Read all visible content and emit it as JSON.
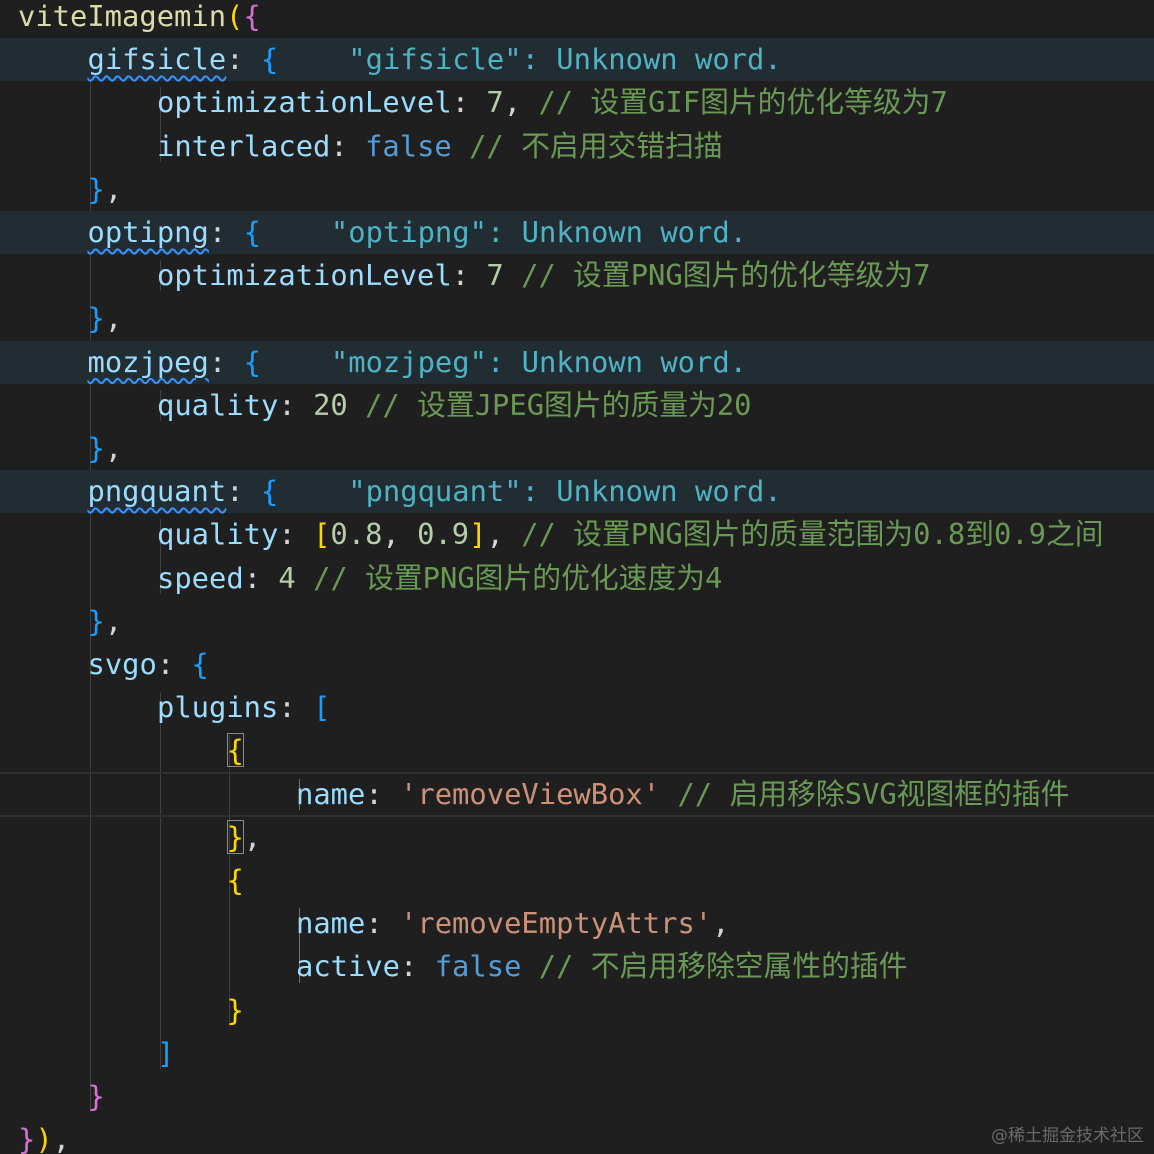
{
  "colors": {
    "background": "#1f1f1f",
    "highlight_row": "#222c33",
    "function": "#dcdcaa",
    "property": "#9cdcfe",
    "number": "#b5cea8",
    "keyword": "#569cd6",
    "string": "#ce9178",
    "comment": "#6a9955",
    "bracket_level1": "#ffd700",
    "bracket_level2": "#da70d6",
    "bracket_level3": "#179fff",
    "diagnostic": "#4fb3c4",
    "squiggle": "#3794ff"
  },
  "lines": [
    {
      "indent": 0,
      "tokens": [
        {
          "t": "viteImagemin",
          "c": "fn"
        },
        {
          "t": "(",
          "c": "b1"
        },
        {
          "t": "{",
          "c": "b2"
        }
      ]
    },
    {
      "indent": 1,
      "highlight": true,
      "diagnostic": "\"gifsicle\": Unknown word.",
      "tokens": [
        {
          "t": "gifsicle",
          "c": "key",
          "squiggle": true
        },
        {
          "t": ": ",
          "c": "punc"
        },
        {
          "t": "{",
          "c": "b3"
        }
      ]
    },
    {
      "indent": 2,
      "tokens": [
        {
          "t": "optimizationLevel",
          "c": "key"
        },
        {
          "t": ": ",
          "c": "punc"
        },
        {
          "t": "7",
          "c": "num"
        },
        {
          "t": ", ",
          "c": "punc"
        },
        {
          "t": "// 设置GIF图片的优化等级为7",
          "c": "cmt"
        }
      ]
    },
    {
      "indent": 2,
      "tokens": [
        {
          "t": "interlaced",
          "c": "key"
        },
        {
          "t": ": ",
          "c": "punc"
        },
        {
          "t": "false",
          "c": "bool"
        },
        {
          "t": " ",
          "c": "punc"
        },
        {
          "t": "// 不启用交错扫描",
          "c": "cmt"
        }
      ]
    },
    {
      "indent": 1,
      "tokens": [
        {
          "t": "}",
          "c": "b3"
        },
        {
          "t": ",",
          "c": "punc"
        }
      ]
    },
    {
      "indent": 1,
      "highlight": true,
      "diagnostic": "\"optipng\": Unknown word.",
      "tokens": [
        {
          "t": "optipng",
          "c": "key",
          "squiggle": true
        },
        {
          "t": ": ",
          "c": "punc"
        },
        {
          "t": "{",
          "c": "b3"
        }
      ]
    },
    {
      "indent": 2,
      "tokens": [
        {
          "t": "optimizationLevel",
          "c": "key"
        },
        {
          "t": ": ",
          "c": "punc"
        },
        {
          "t": "7",
          "c": "num"
        },
        {
          "t": " ",
          "c": "punc"
        },
        {
          "t": "// 设置PNG图片的优化等级为7",
          "c": "cmt"
        }
      ]
    },
    {
      "indent": 1,
      "tokens": [
        {
          "t": "}",
          "c": "b3"
        },
        {
          "t": ",",
          "c": "punc"
        }
      ]
    },
    {
      "indent": 1,
      "highlight": true,
      "diagnostic": "\"mozjpeg\": Unknown word.",
      "tokens": [
        {
          "t": "mozjpeg",
          "c": "key",
          "squiggle": true
        },
        {
          "t": ": ",
          "c": "punc"
        },
        {
          "t": "{",
          "c": "b3"
        }
      ]
    },
    {
      "indent": 2,
      "tokens": [
        {
          "t": "quality",
          "c": "key"
        },
        {
          "t": ": ",
          "c": "punc"
        },
        {
          "t": "20",
          "c": "num"
        },
        {
          "t": " ",
          "c": "punc"
        },
        {
          "t": "// 设置JPEG图片的质量为20",
          "c": "cmt"
        }
      ]
    },
    {
      "indent": 1,
      "tokens": [
        {
          "t": "}",
          "c": "b3"
        },
        {
          "t": ",",
          "c": "punc"
        }
      ]
    },
    {
      "indent": 1,
      "highlight": true,
      "diagnostic": "\"pngquant\": Unknown word.",
      "tokens": [
        {
          "t": "pngquant",
          "c": "key",
          "squiggle": true
        },
        {
          "t": ": ",
          "c": "punc"
        },
        {
          "t": "{",
          "c": "b3"
        }
      ]
    },
    {
      "indent": 2,
      "tokens": [
        {
          "t": "quality",
          "c": "key"
        },
        {
          "t": ": ",
          "c": "punc"
        },
        {
          "t": "[",
          "c": "b1"
        },
        {
          "t": "0.8",
          "c": "num"
        },
        {
          "t": ", ",
          "c": "punc"
        },
        {
          "t": "0.9",
          "c": "num"
        },
        {
          "t": "]",
          "c": "b1"
        },
        {
          "t": ", ",
          "c": "punc"
        },
        {
          "t": "// 设置PNG图片的质量范围为0.8到0.9之间",
          "c": "cmt"
        }
      ]
    },
    {
      "indent": 2,
      "tokens": [
        {
          "t": "speed",
          "c": "key"
        },
        {
          "t": ": ",
          "c": "punc"
        },
        {
          "t": "4",
          "c": "num"
        },
        {
          "t": " ",
          "c": "punc"
        },
        {
          "t": "// 设置PNG图片的优化速度为4",
          "c": "cmt"
        }
      ]
    },
    {
      "indent": 1,
      "tokens": [
        {
          "t": "}",
          "c": "b3"
        },
        {
          "t": ",",
          "c": "punc"
        }
      ]
    },
    {
      "indent": 1,
      "tokens": [
        {
          "t": "svgo",
          "c": "key"
        },
        {
          "t": ": ",
          "c": "punc"
        },
        {
          "t": "{",
          "c": "b3"
        }
      ]
    },
    {
      "indent": 2,
      "tokens": [
        {
          "t": "plugins",
          "c": "key"
        },
        {
          "t": ": ",
          "c": "punc"
        },
        {
          "t": "[",
          "c": "b3"
        }
      ]
    },
    {
      "indent": 3,
      "tokens": [
        {
          "t": "{",
          "c": "b1",
          "match": true
        }
      ]
    },
    {
      "indent": 4,
      "current": true,
      "tokens": [
        {
          "t": "name",
          "c": "key"
        },
        {
          "t": ": ",
          "c": "punc"
        },
        {
          "t": "'removeViewBox'",
          "c": "str"
        },
        {
          "t": " ",
          "c": "punc"
        },
        {
          "t": "// 启用移除SVG视图框的插件",
          "c": "cmt"
        }
      ]
    },
    {
      "indent": 3,
      "tokens": [
        {
          "t": "}",
          "c": "b1",
          "match": true
        },
        {
          "t": ",",
          "c": "punc"
        }
      ]
    },
    {
      "indent": 3,
      "tokens": [
        {
          "t": "{",
          "c": "b1"
        }
      ]
    },
    {
      "indent": 4,
      "tokens": [
        {
          "t": "name",
          "c": "key"
        },
        {
          "t": ": ",
          "c": "punc"
        },
        {
          "t": "'removeEmptyAttrs'",
          "c": "str"
        },
        {
          "t": ",",
          "c": "punc"
        }
      ]
    },
    {
      "indent": 4,
      "tokens": [
        {
          "t": "active",
          "c": "key"
        },
        {
          "t": ": ",
          "c": "punc"
        },
        {
          "t": "false",
          "c": "bool"
        },
        {
          "t": " ",
          "c": "punc"
        },
        {
          "t": "// 不启用移除空属性的插件",
          "c": "cmt"
        }
      ]
    },
    {
      "indent": 3,
      "tokens": [
        {
          "t": "}",
          "c": "b1"
        }
      ]
    },
    {
      "indent": 2,
      "tokens": [
        {
          "t": "]",
          "c": "b3"
        }
      ]
    },
    {
      "indent": 1,
      "tokens": [
        {
          "t": "}",
          "c": "b2"
        }
      ]
    },
    {
      "indent": 0,
      "tokens": [
        {
          "t": "}",
          "c": "b2"
        },
        {
          "t": ")",
          "c": "b1"
        },
        {
          "t": ",",
          "c": "punc"
        }
      ]
    }
  ],
  "watermark": "@稀土掘金技术社区"
}
